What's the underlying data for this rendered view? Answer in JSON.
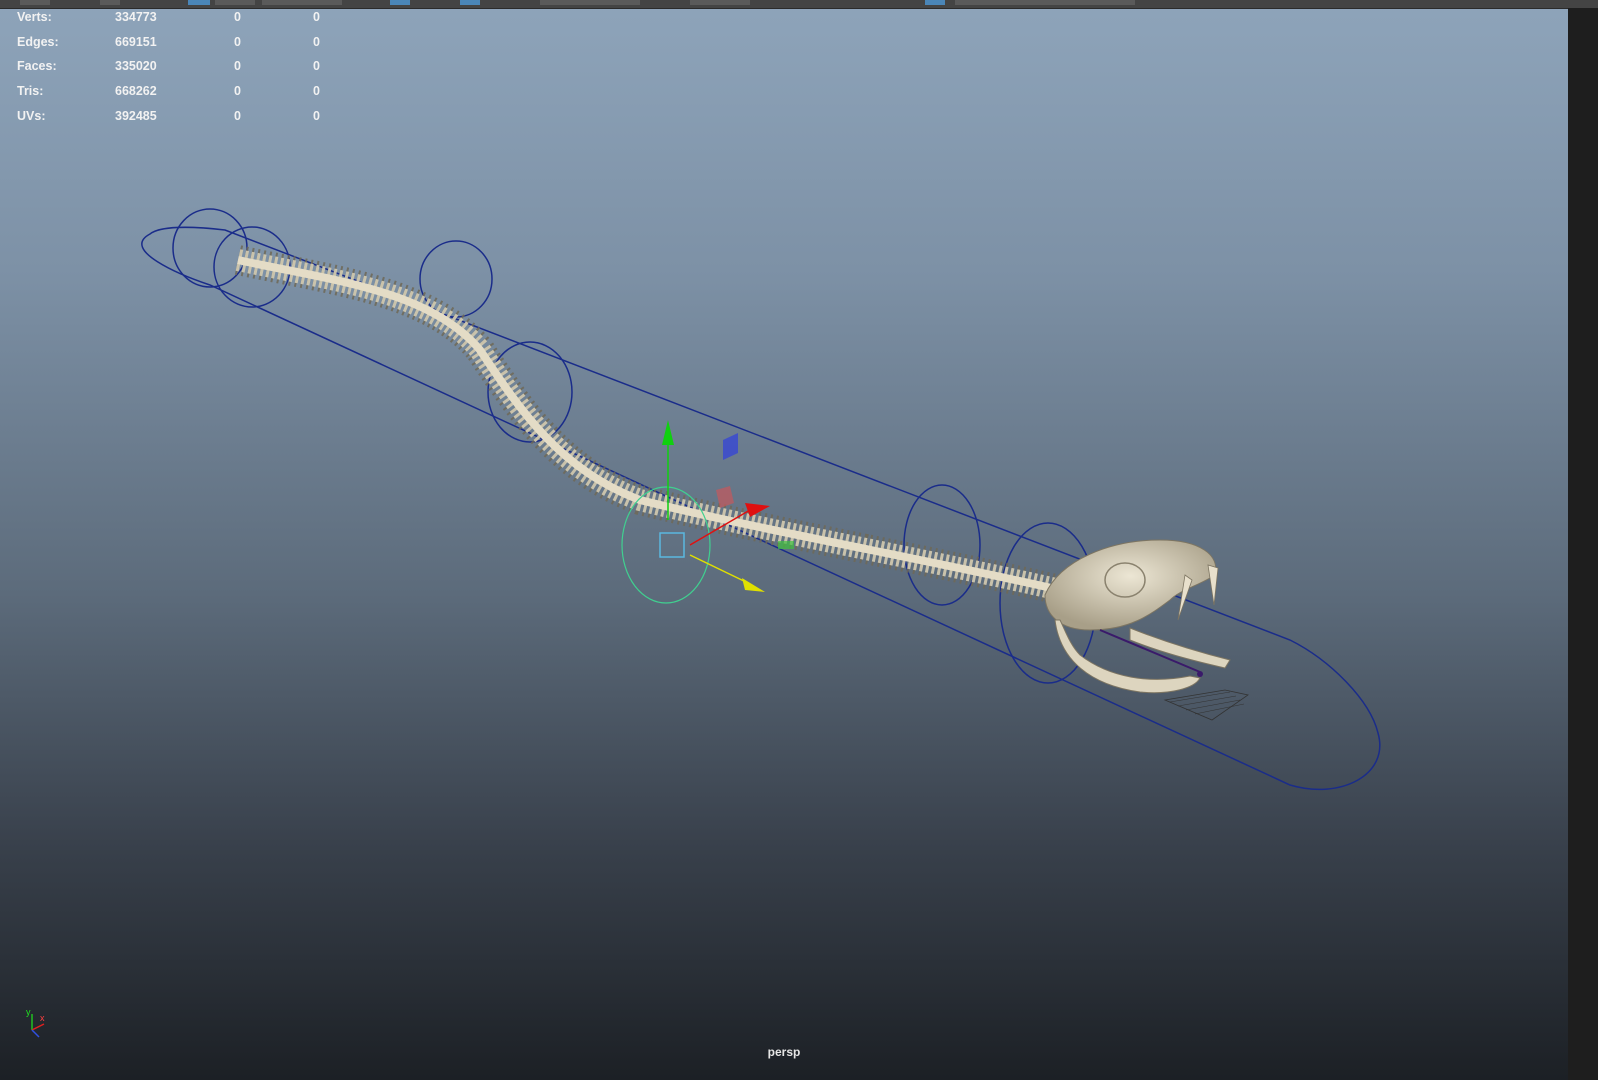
{
  "hud": {
    "rows": [
      {
        "label": "Verts:",
        "total": "334773",
        "selected": "0",
        "highlighted": "0"
      },
      {
        "label": "Edges:",
        "total": "669151",
        "selected": "0",
        "highlighted": "0"
      },
      {
        "label": "Faces:",
        "total": "335020",
        "selected": "0",
        "highlighted": "0"
      },
      {
        "label": "Tris:",
        "total": "668262",
        "selected": "0",
        "highlighted": "0"
      },
      {
        "label": "UVs:",
        "total": "392485",
        "selected": "0",
        "highlighted": "0"
      }
    ]
  },
  "viewport": {
    "camera_name": "persp",
    "axis_labels": {
      "y": "y",
      "x": "x",
      "z": "z"
    }
  },
  "colors": {
    "bone": "#d8d0b8",
    "control_curve": "#1a2c8a",
    "gizmo_x": "#e01010",
    "gizmo_y": "#10d010",
    "gizmo_z": "#e0e000",
    "selection_ring": "#40d090",
    "plane_handle_blue": "#3a4ad0"
  }
}
